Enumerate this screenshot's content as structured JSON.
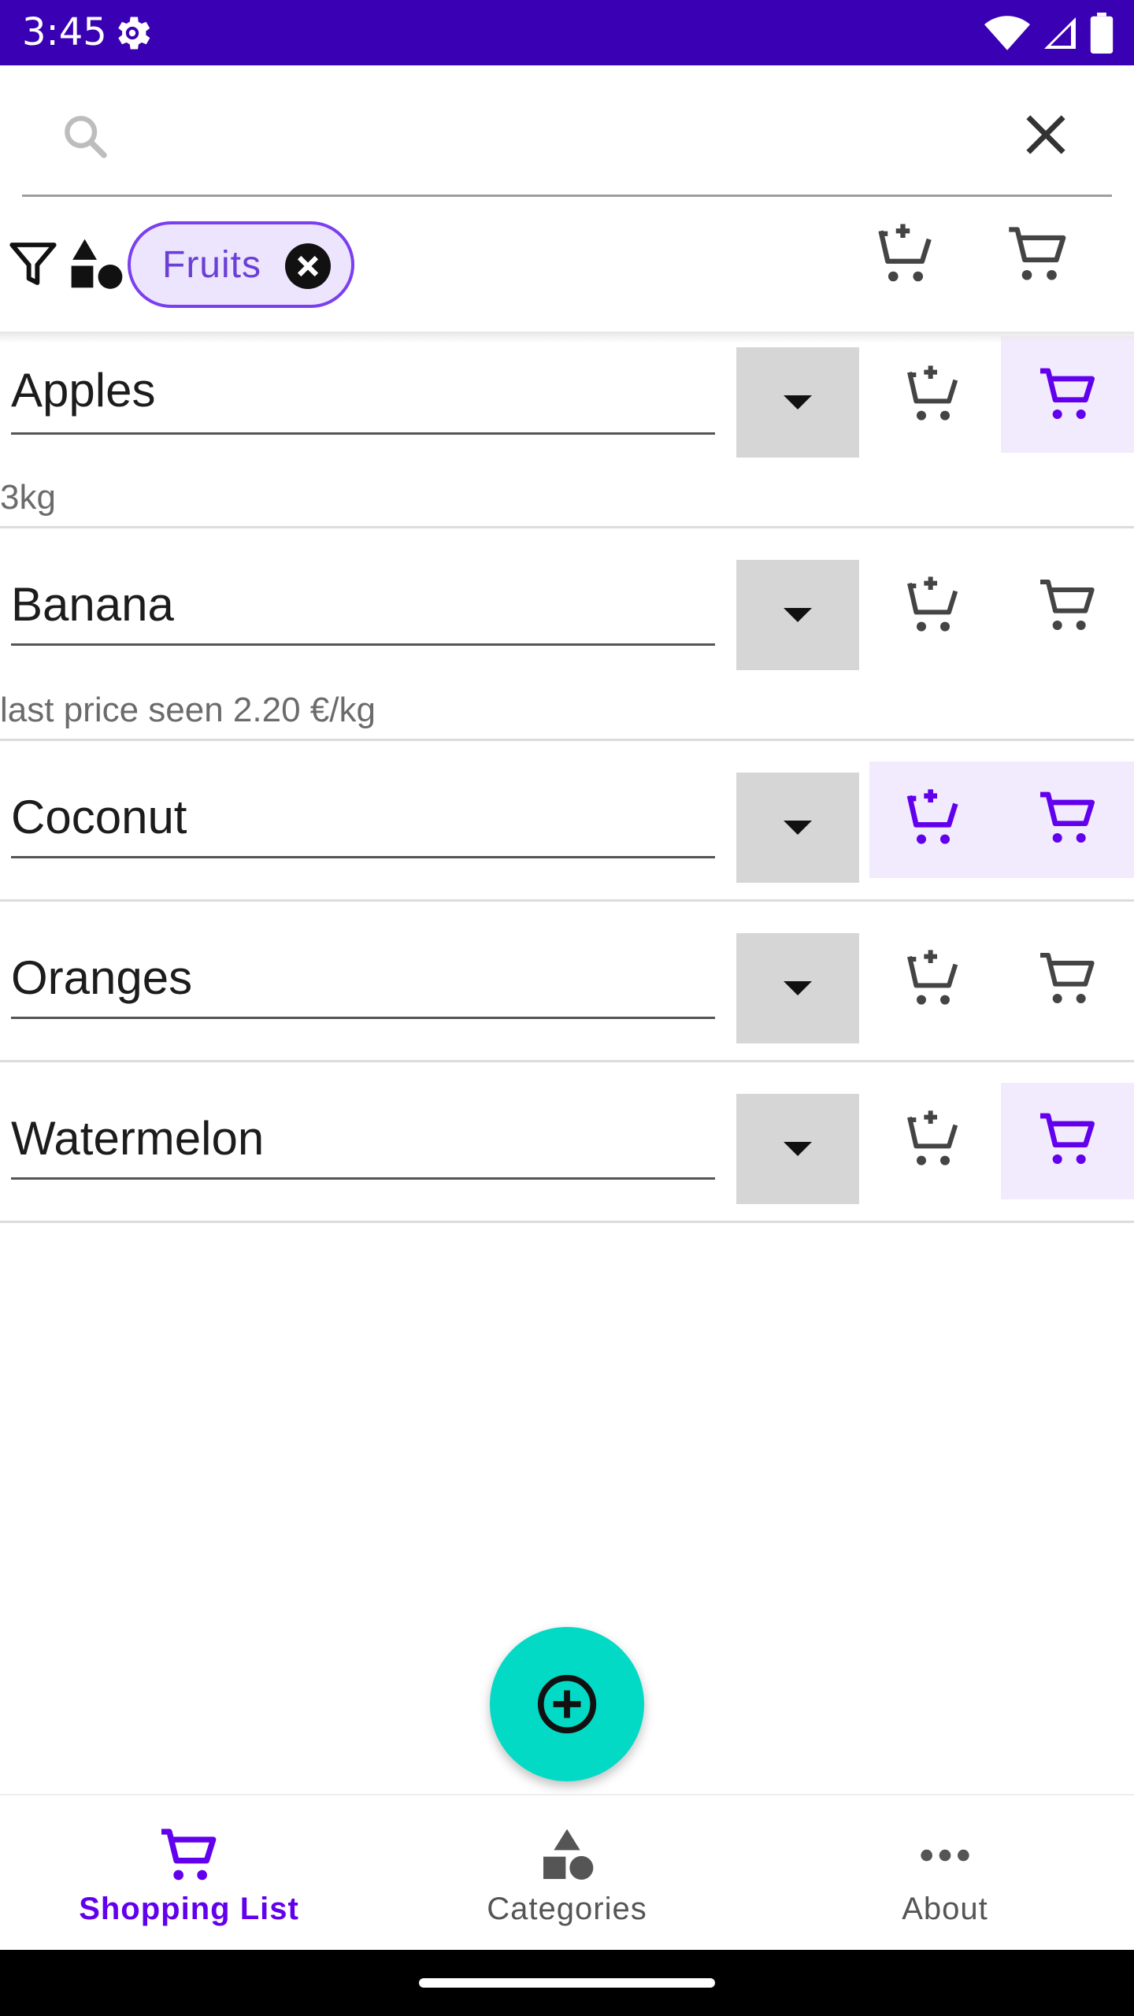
{
  "status_bar": {
    "time": "3:45"
  },
  "search": {
    "value": "",
    "placeholder": ""
  },
  "filter": {
    "chip_label": "Fruits"
  },
  "items": [
    {
      "name": "Apples",
      "note": "3kg",
      "in_list": false,
      "in_cart": true
    },
    {
      "name": "Banana",
      "note": "last price seen 2.20 €/kg",
      "in_list": false,
      "in_cart": false
    },
    {
      "name": "Coconut",
      "note": "",
      "in_list": true,
      "in_cart": true
    },
    {
      "name": "Oranges",
      "note": "",
      "in_list": false,
      "in_cart": false
    },
    {
      "name": "Watermelon",
      "note": "",
      "in_list": false,
      "in_cart": true
    }
  ],
  "bottom_nav": {
    "items": [
      {
        "label": "Shopping List",
        "icon": "cart-icon",
        "active": true
      },
      {
        "label": "Categories",
        "icon": "shapes-icon",
        "active": false
      },
      {
        "label": "About",
        "icon": "more-horizontal-icon",
        "active": false
      }
    ]
  },
  "colors": {
    "status_bar": "#3a00b4",
    "accent": "#6200ee",
    "chip_border": "#7b3ff0",
    "chip_bg": "#ede5fd",
    "fab": "#03dac6",
    "selected_bg": "#f1ebfd"
  }
}
